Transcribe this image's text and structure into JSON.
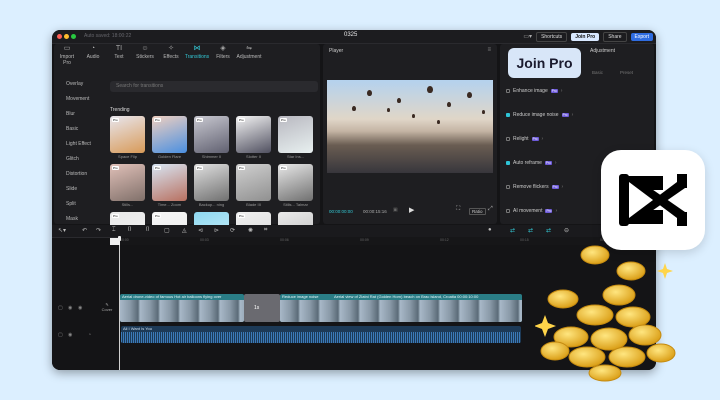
{
  "titlebar": {
    "autosave": "Auto saved: 18:00:22",
    "title": "0325",
    "shortcuts": "Shortcuts",
    "join_pro": "Join Pro",
    "share": "Share",
    "export": "Export"
  },
  "media": {
    "tabs": [
      {
        "label": "Import",
        "icon": "import-icon",
        "glyph": "▭",
        "sub": "Pro"
      },
      {
        "label": "Audio",
        "icon": "audio-icon",
        "glyph": "◔"
      },
      {
        "label": "Text",
        "icon": "text-icon",
        "glyph": "TI"
      },
      {
        "label": "Stickers",
        "icon": "sticker-icon",
        "glyph": "☺"
      },
      {
        "label": "Effects",
        "icon": "effects-icon",
        "glyph": "✧"
      },
      {
        "label": "Transitions",
        "icon": "transitions-icon",
        "glyph": "⋈"
      },
      {
        "label": "Filters",
        "icon": "filters-icon",
        "glyph": "◈"
      },
      {
        "label": "Adjustment",
        "icon": "adjust-icon",
        "glyph": "⇋"
      }
    ],
    "categories": [
      "Overlay",
      "Movement",
      "Blur",
      "Basic",
      "Light Effect",
      "Glitch",
      "Distortion",
      "Slide",
      "Split",
      "Mask"
    ],
    "search_placeholder": "Search for transitions",
    "section": "Trending",
    "thumbs": [
      {
        "label": "Space Flip",
        "pro": "Pro",
        "c1": "#e8e6ee",
        "c2": "#d89a58"
      },
      {
        "label": "Golden Flare",
        "pro": "Pro",
        "c1": "#f0d0c0",
        "c2": "#4a8fe0"
      },
      {
        "label": "Shimmer II",
        "pro": "Pro",
        "c1": "#c8c8d0",
        "c2": "#606070"
      },
      {
        "label": "Slotter II",
        "pro": "Pro",
        "c1": "#f4f4f4",
        "c2": "#505060"
      },
      {
        "label": "Star Ins...",
        "pro": "Pro",
        "c1": "#b8b8c0",
        "c2": "#e8f0f0"
      },
      {
        "label": "Stills...",
        "pro": "Pro",
        "c1": "#e0c0b8",
        "c2": "#80706a"
      },
      {
        "label": "Time... Zoom",
        "pro": "Pro",
        "c1": "#d8e6f4",
        "c2": "#b87060"
      },
      {
        "label": "Backup... ning",
        "pro": "Pro",
        "c1": "#e0e0e0",
        "c2": "#707070"
      },
      {
        "label": "Blade III",
        "pro": "Pro",
        "c1": "#d0d0d0",
        "c2": "#909090"
      },
      {
        "label": "Stills... Talmar",
        "pro": "Pro",
        "c1": "#e8e8e8",
        "c2": "#707070"
      },
      {
        "label": "",
        "pro": "Pro",
        "c1": "#e8e8e8",
        "c2": "#f4f4f4"
      },
      {
        "label": "",
        "pro": "Pro",
        "c1": "#f6f6f6",
        "c2": "#ececec"
      },
      {
        "label": "",
        "pro": "",
        "c1": "#8ed8f0",
        "c2": "#d0f0fa"
      },
      {
        "label": "",
        "pro": "Pro",
        "c1": "#f0f0f0",
        "c2": "#d8d8d8"
      },
      {
        "label": "",
        "pro": "",
        "c1": "#eaeaea",
        "c2": "#bcbcbc"
      }
    ]
  },
  "player": {
    "label": "Player",
    "time_current": "00:00:00:00",
    "time_total": "00:00:15:16",
    "ratio": "Ratio"
  },
  "adjust": {
    "tab": "Adjustment",
    "subtab_basic": "Basic",
    "subtab_preset": "Preset",
    "rows": [
      {
        "label": "Enhance image",
        "on": false,
        "pro": "Pro"
      },
      {
        "label": "Reduce image noise",
        "on": true,
        "pro": "Pro"
      },
      {
        "label": "Relight",
        "on": false,
        "pro": "Pro"
      },
      {
        "label": "Auto reframe",
        "on": true,
        "pro": "Pro"
      },
      {
        "label": "Remove flickers",
        "on": false,
        "pro": "Pro"
      },
      {
        "label": "AI movement",
        "on": false,
        "pro": "Pro"
      }
    ]
  },
  "popup": {
    "join_pro": "Join Pro"
  },
  "timeline": {
    "ticks": [
      "00:00",
      "00:03",
      "00:06",
      "00:09",
      "00:12",
      "00:15",
      "00:18"
    ],
    "track_label": "Cover",
    "clip1": "Aerial drone-video of famous Hot air balloons flying over",
    "clip2": "Aerial view of Zlatni Rat (Golden Horn) beach on Brac island, Croatia 00:00:10:00",
    "clip2b": "Reduce image noise",
    "marker": "1s",
    "audio": "All I Want Is You"
  },
  "colors": {
    "accent": "#33c7d4",
    "export": "#2f6ce0",
    "pro": "#6d5ad9"
  }
}
